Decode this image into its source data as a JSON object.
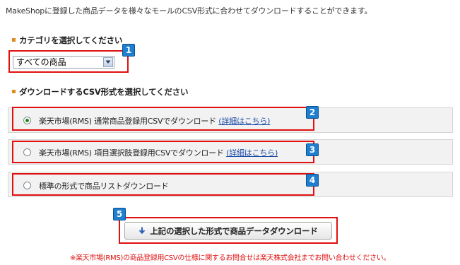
{
  "intro_text": "MakeShopに登録した商品データを様々なモールのCSV形式に合わせてダウンロードすることができます。",
  "category_section": {
    "title": "カテゴリを選択してください",
    "selected": "すべての商品"
  },
  "format_section": {
    "title": "ダウンロードするCSV形式を選択してください",
    "options": [
      {
        "label": "楽天市場(RMS) 通常商品登録用CSVでダウンロード",
        "link": "(詳細はこちら)",
        "checked": true
      },
      {
        "label": "楽天市場(RMS) 項目選択肢登録用CSVでダウンロード",
        "link": "(詳細はこちら)",
        "checked": false
      },
      {
        "label": "標準の形式で商品リストダウンロード",
        "link": "",
        "checked": false
      }
    ]
  },
  "download_button": {
    "label": "上記の選択した形式で商品データダウンロード",
    "icon": "arrow-down-icon"
  },
  "note": "※楽天市場(RMS)の商品登録用CSVの仕様に関するお問合せは楽天株式会社までお問い合わせください。",
  "badges": [
    "1",
    "2",
    "3",
    "4",
    "5"
  ],
  "colors": {
    "highlight": "#e01010",
    "badge": "#1e7fd0",
    "bullet": "#e08a1e",
    "link": "#1a4aa8",
    "radio_checked": "#1a8a1a"
  }
}
